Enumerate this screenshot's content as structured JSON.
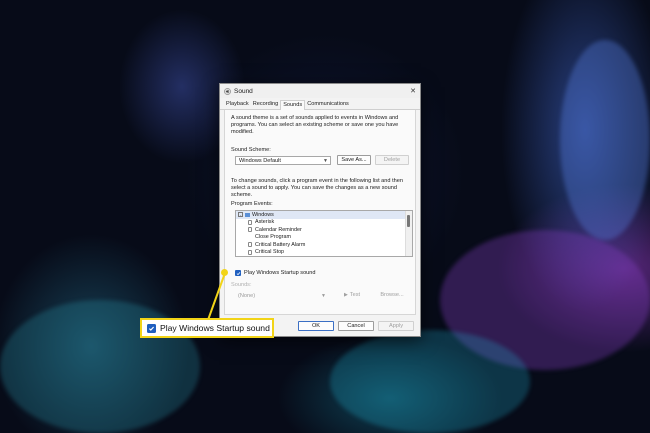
{
  "window": {
    "title": "Sound",
    "close_glyph": "✕",
    "tabs": [
      "Playback",
      "Recording",
      "Sounds",
      "Communications"
    ],
    "active_tab": "Sounds"
  },
  "sounds_tab": {
    "description": "A sound theme is a set of sounds applied to events in Windows and programs. You can select an existing scheme or save one you have modified.",
    "scheme_label": "Sound Scheme:",
    "scheme_value": "Windows Default",
    "save_as_label": "Save As...",
    "delete_label": "Delete",
    "change_description": "To change sounds, click a program event in the following list and then select a sound to apply. You can save the changes as a new sound scheme.",
    "events_label": "Program Events:",
    "events": [
      {
        "name": "Windows",
        "root": true
      },
      {
        "name": "Asterisk"
      },
      {
        "name": "Calendar Reminder"
      },
      {
        "name": "Close Program"
      },
      {
        "name": "Critical Battery Alarm"
      },
      {
        "name": "Critical Stop"
      }
    ],
    "startup_checkbox_label": "Play Windows Startup sound",
    "startup_checked": true,
    "sounds_label": "Sounds:",
    "sounds_value": "(None)",
    "test_label": "Test",
    "browse_label": "Browse..."
  },
  "dialog_buttons": {
    "ok": "OK",
    "cancel": "Cancel",
    "apply": "Apply"
  },
  "callout": {
    "label": "Play Windows Startup sound",
    "checked": true,
    "color": "#f2d417"
  },
  "colors": {
    "accent": "#1f5fbf",
    "highlight": "#f2d417"
  }
}
